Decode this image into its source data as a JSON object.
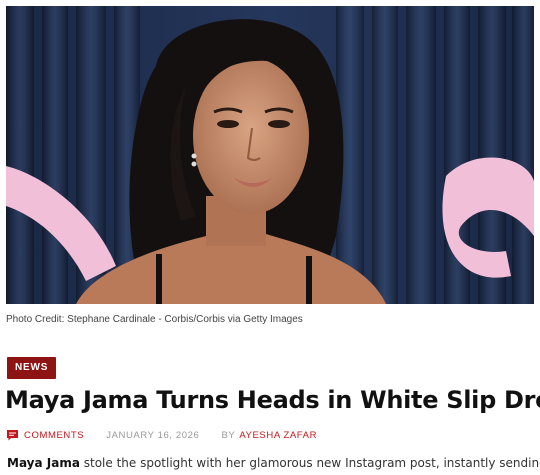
{
  "hero": {
    "image_icon": "portrait-photo",
    "credit": "Photo Credit: Stephane Cardinale - Corbis/Corbis via Getty Images"
  },
  "article": {
    "category": "NEWS",
    "title": "Maya Jama Turns Heads in White Slip Dress",
    "meta": {
      "comments_label": "COMMENTS",
      "comments_icon": "comment-icon",
      "date": "JANUARY 16, 2026",
      "by_label": "BY",
      "author": "AYESHA ZAFAR"
    },
    "excerpt": {
      "lead": "Maya Jama",
      "text": " stole the spotlight with her glamorous new Instagram post, instantly sending fans"
    }
  },
  "colors": {
    "badge_bg": "#8e1313",
    "accent": "#c4161c",
    "meta_gray": "#999999",
    "curtain": "#1f2f4f",
    "pink_sign": "#f2bfd8"
  }
}
